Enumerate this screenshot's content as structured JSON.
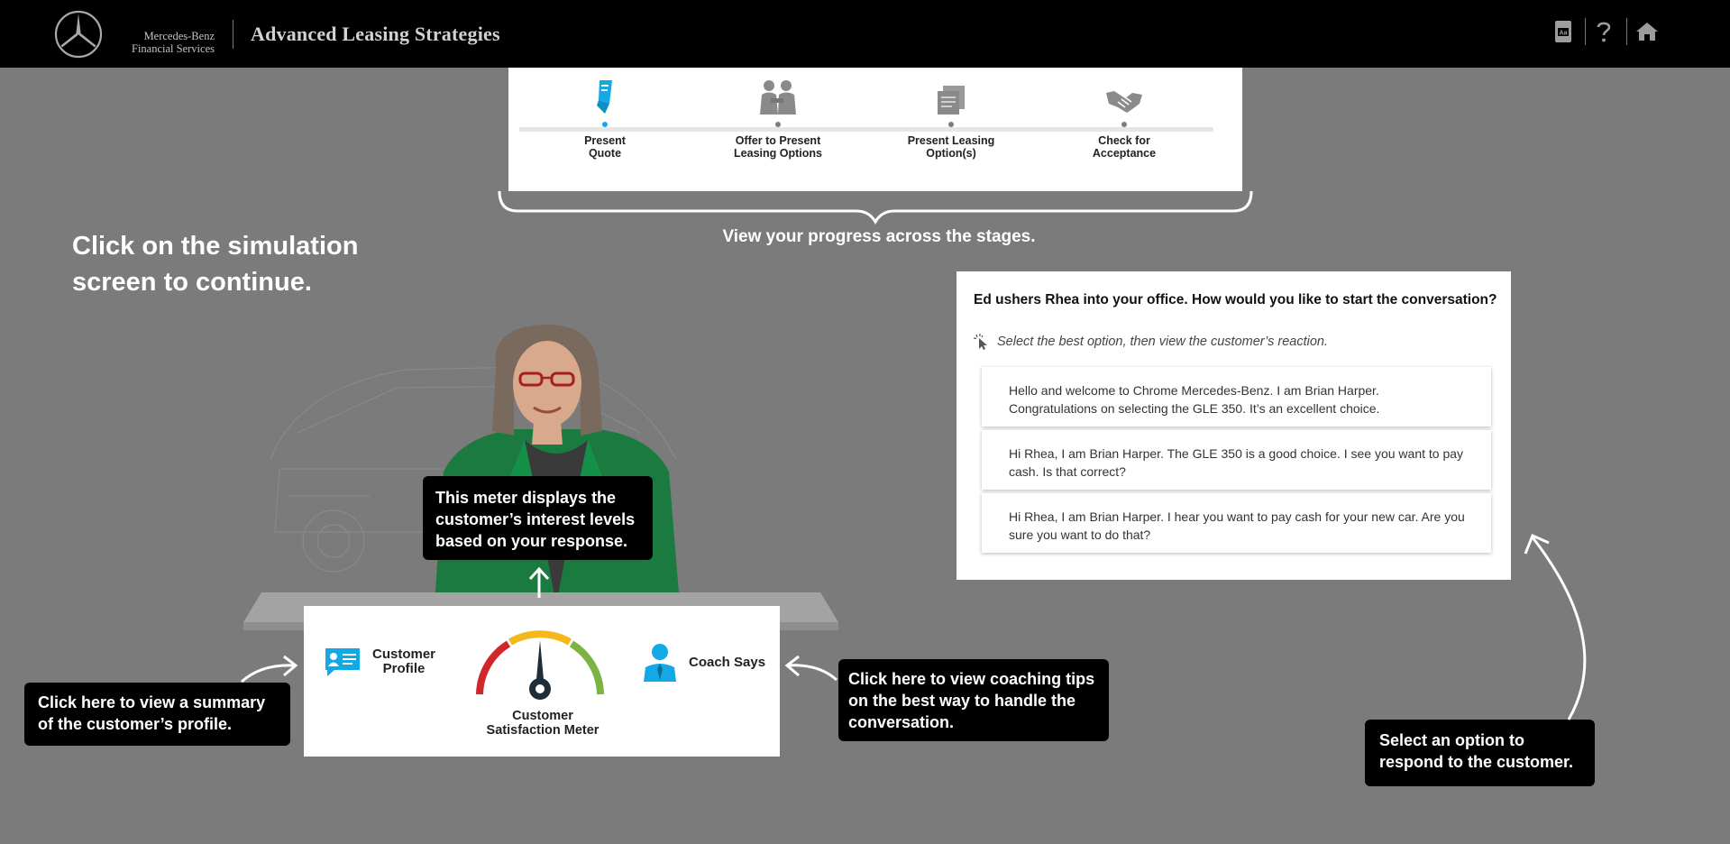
{
  "header": {
    "brand_line1": "Mercedes-Benz",
    "brand_line2": "Financial Services",
    "title": "Advanced Leasing Strategies",
    "icons": [
      "glossary-icon",
      "help-icon",
      "home-icon"
    ]
  },
  "stages": [
    {
      "label_line1": "Present",
      "label_line2": "Quote",
      "icon": "quote-document-icon",
      "active": true
    },
    {
      "label_line1": "Offer to Present",
      "label_line2": "Leasing Options",
      "icon": "two-people-icon",
      "active": false
    },
    {
      "label_line1": "Present Leasing",
      "label_line2": "Option(s)",
      "icon": "documents-icon",
      "active": false
    },
    {
      "label_line1": "Check for",
      "label_line2": "Acceptance",
      "icon": "handshake-icon",
      "active": false
    }
  ],
  "progress_caption": "View your progress across the stages.",
  "instruction": {
    "line1": "Click on the simulation",
    "line2": "screen to continue."
  },
  "panel": {
    "customer_profile_line1": "Customer",
    "customer_profile_line2": "Profile",
    "meter_line1": "Customer",
    "meter_line2": "Satisfaction Meter",
    "coach_label": "Coach Says",
    "meter_level": 0.5
  },
  "tips": {
    "meter": {
      "line1": "This meter displays the",
      "line2": "customer’s interest levels",
      "line3": "based on your response."
    },
    "profile": {
      "line1": "Click here to view a summary",
      "line2": "of the customer’s profile."
    },
    "coach": {
      "line1": "Click here to view coaching tips",
      "line2": "on the best way to handle the",
      "line3": "conversation."
    },
    "select": {
      "line1": "Select an option to",
      "line2": "respond to the customer."
    }
  },
  "dialog": {
    "question": "Ed ushers Rhea into your office. How would you like to start the conversation?",
    "hint": "Select the best option, then view the customer’s reaction.",
    "options": [
      {
        "line1": "Hello and welcome to Chrome Mercedes-Benz. I am Brian Harper.",
        "line2": "Congratulations on selecting the GLE 350. It’s an excellent choice."
      },
      {
        "line1": "Hi Rhea, I am Brian Harper. The GLE 350 is a good choice. I see you want to pay",
        "line2": "cash. Is that correct?"
      },
      {
        "line1": "Hi Rhea, I am Brian Harper. I hear you want to pay cash for your new car. Are you",
        "line2": "sure you want to do that?"
      }
    ]
  },
  "colors": {
    "accent": "#13a8e6",
    "header_bg": "#000000",
    "overlay": "#7b7b7b",
    "meter_red": "#d0262c",
    "meter_yellow": "#f4b81c",
    "meter_green": "#7cb342"
  }
}
